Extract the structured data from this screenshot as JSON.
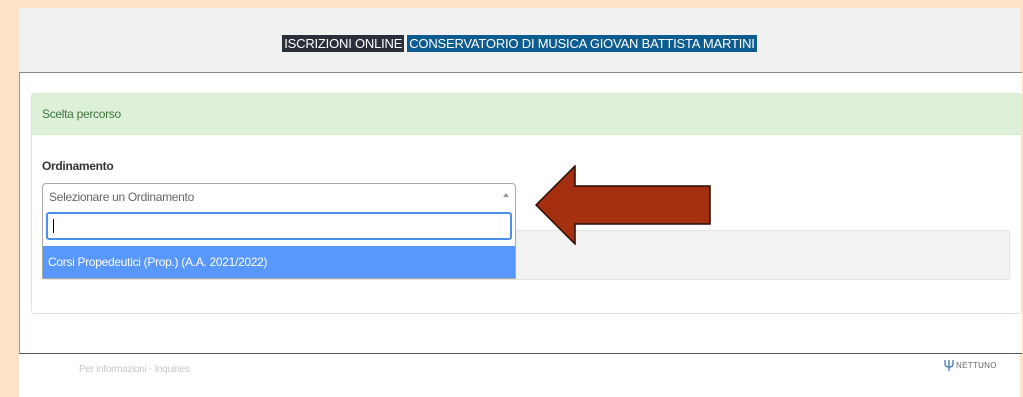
{
  "header": {
    "title_part1": "ISCRIZIONI ONLINE",
    "title_part2": "CONSERVATORIO DI MUSICA GIOVAN BATTISTA MARTINI"
  },
  "panel": {
    "heading": "Scelta percorso",
    "field_label": "Ordinamento",
    "select_placeholder": "Selezionare un Ordinamento",
    "search_value": "",
    "options": [
      "Corsi Propedeutici (Prop.) (A.A. 2021/2022)"
    ]
  },
  "annotation": {
    "arrow_icon": "left-arrow-icon",
    "arrow_color": "#a4300f"
  },
  "footer": {
    "info_text": "Per informazioni - Inquiries",
    "logo_text": "NETTUNO"
  },
  "colors": {
    "header_bg": "#f1f1f1",
    "panel_head_bg": "#dff0d8",
    "option_highlight": "#5897fb",
    "search_border": "#4c8ee8",
    "title_dark_bg": "#2b2f3a",
    "title_blue_bg": "#0c5c8f"
  }
}
